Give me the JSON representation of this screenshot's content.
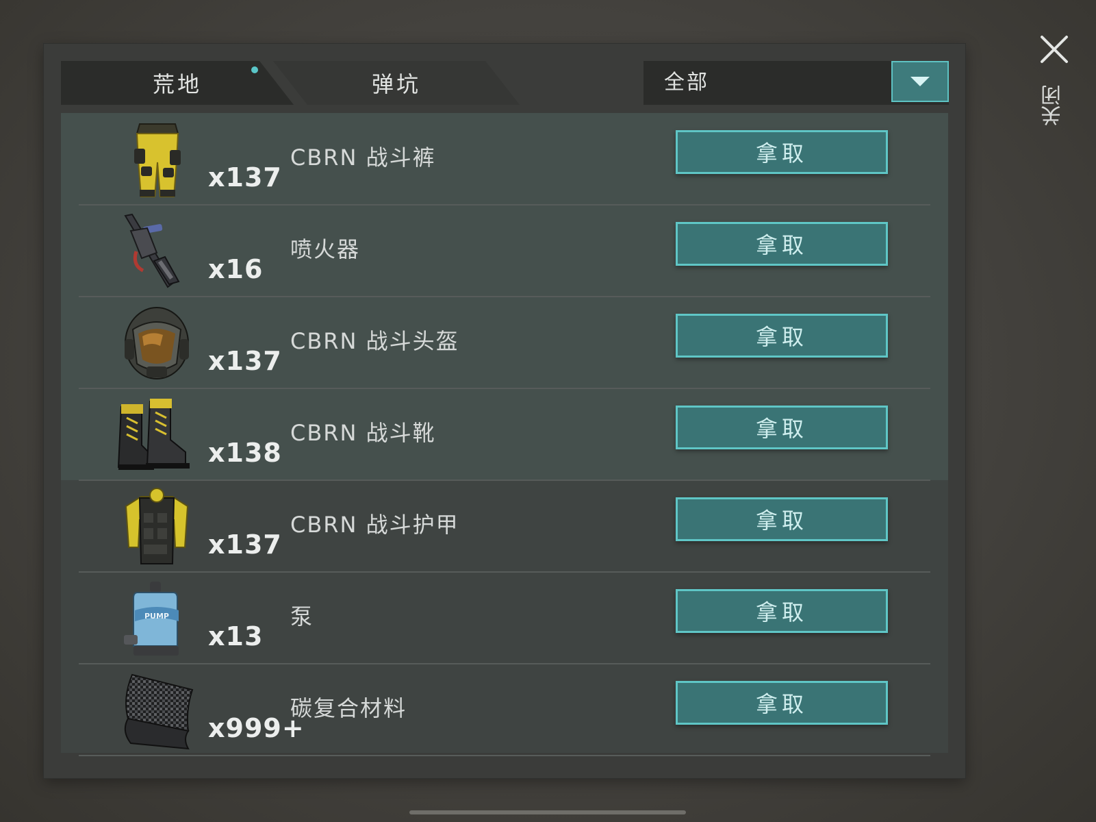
{
  "tabs": [
    {
      "label": "荒地",
      "active": true,
      "has_dot": true
    },
    {
      "label": "弹坑",
      "active": false
    }
  ],
  "filter": {
    "selected": "全部"
  },
  "close": {
    "label": "关闭"
  },
  "items": [
    {
      "icon": "cbrn-pants-icon",
      "quantity": "x137",
      "name": "CBRN 战斗裤",
      "action": "拿取"
    },
    {
      "icon": "flamethrower-icon",
      "quantity": "x16",
      "name": "喷火器",
      "action": "拿取"
    },
    {
      "icon": "cbrn-helmet-icon",
      "quantity": "x137",
      "name": "CBRN 战斗头盔",
      "action": "拿取"
    },
    {
      "icon": "cbrn-boots-icon",
      "quantity": "x138",
      "name": "CBRN 战斗靴",
      "action": "拿取"
    },
    {
      "icon": "cbrn-armor-icon",
      "quantity": "x137",
      "name": "CBRN 战斗护甲",
      "action": "拿取"
    },
    {
      "icon": "pump-icon",
      "quantity": "x13",
      "name": "泵",
      "action": "拿取",
      "icon_text": "PUMP"
    },
    {
      "icon": "carbon-composite-icon",
      "quantity": "x999+",
      "name": "碳复合材料",
      "action": "拿取"
    }
  ],
  "colors": {
    "accent": "#5fc6c6",
    "button_fill": "#3a7475",
    "panel": "#3b3c3a"
  }
}
